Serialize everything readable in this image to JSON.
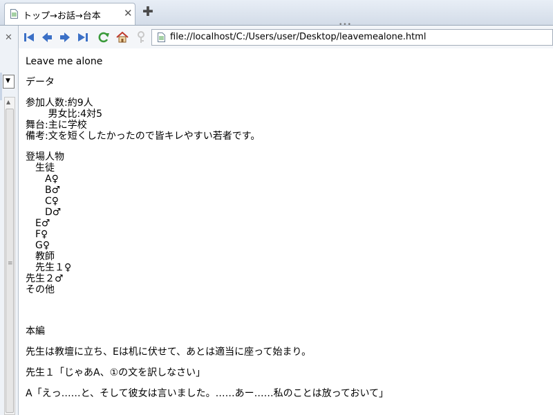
{
  "tab": {
    "title": "トップ→お話→台本",
    "close_symbol": "✕",
    "new_tab_symbol": "✚"
  },
  "toolbar_grip": "•••",
  "left_pane": {
    "close_symbol": "✕",
    "dropdown_arrow": "▼",
    "scroll_up_symbol": "▲",
    "scroll_grip_symbol": "≡"
  },
  "navigation": {
    "buttons": [
      "first-icon",
      "back-icon",
      "forward-icon",
      "last-icon",
      "reload-icon",
      "home-icon",
      "key-icon"
    ],
    "url": "file://localhost/C:/Users/user/Desktop/leavemealone.html"
  },
  "colors": {
    "nav_arrow": "#3b70c6",
    "reload": "#3a9a3a",
    "home": "#c0392b",
    "key": "#c8c8c8"
  },
  "document": {
    "title": "Leave me alone",
    "data_heading": "データ",
    "participants": "参加人数:約9人",
    "gender_ratio": "　　 男女比:4対5",
    "stage": "舞台:主に学校",
    "note": "備考:文を短くしたかったので皆キレやすい若者です。",
    "cast_heading": "登場人物",
    "cast": [
      "　生徒",
      "　　A♀",
      "　　B♂",
      "　　C♀",
      "　　D♂",
      "　E♂",
      "　F♀",
      "　G♀",
      "　教師",
      "　先生１♀",
      "先生２♂",
      "その他"
    ],
    "main_heading": "本編",
    "script": [
      "先生は教壇に立ち、Eは机に伏せて、あとは適当に座って始まり。",
      "先生１「じゃあA、①の文を訳しなさい」",
      "A「えっ……と、そして彼女は言いました。……あー……私のことは放っておいて」"
    ]
  }
}
